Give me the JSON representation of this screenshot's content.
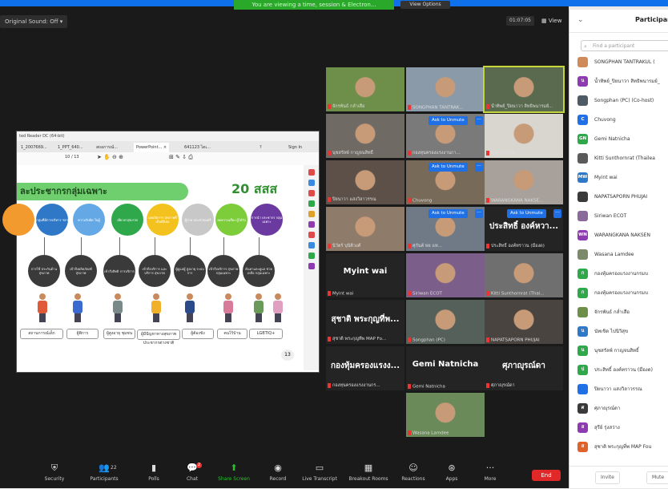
{
  "banner": {
    "text": "You are viewing a time, session & Electron...",
    "button": "View Options"
  },
  "topbar": {
    "sound": "Original Sound: Off ▾",
    "timer": "01:07:05",
    "view": "▦ View"
  },
  "slide": {
    "app_title": "ted Reader DC (64-bit)",
    "tabs": [
      "1_2007669...",
      "1_PPT_640...",
      "สถอการณ์...",
      "PowerPoint... ×",
      "641123 ไดเ...",
      "?",
      "Sign In"
    ],
    "zoom": "10 / 13",
    "header": "ละประชากรกลุ่มเฉพาะ",
    "logo": "20 สสส",
    "page_number": "13",
    "top_circles": [
      {
        "text": "",
        "color": "#f39a2e"
      },
      {
        "text": "กลุ่มที่มีการบริหาร ฯลฯ",
        "color": "#2f77c7"
      },
      {
        "text": "ความรับผิด ในผู้",
        "color": "#64a9e6"
      },
      {
        "text": "เยียวยาสุขภาพ",
        "color": "#2fa84c"
      },
      {
        "text": "ผลผลิตการ สุขภาพที่เป็นที่นิยม",
        "color": "#f4c21f"
      },
      {
        "text": "ผู้ป่วย ประชาชนตรี",
        "color": "#c8c8c8"
      },
      {
        "text": "ลดความเสี่ยง ผู้ได้รับ",
        "color": "#7dcc3a"
      },
      {
        "text": "การนำ ประชากร กลุ่มเฉพาะ",
        "color": "#6b3aa0"
      }
    ],
    "bottom_circles": [
      "การใช้ ประกันด้าน สุขภาพ",
      "เข้าถึงผลิตภัณฑ์ สุขภาพ",
      "เข้าถึงสิทธิ การบริการ",
      "เข้าถึงบริการ และบริการ สุขภาพ",
      "ผู้ดูแลผู้ สูงอายุ ระบบการ",
      "เข้าถึงบริการ สุขภาพ กลุ่มเฉพาะ",
      "ค้นหาและดูแล ช่วยเหลือ กลุ่มเฉพาะ"
    ],
    "labels": [
      "สถานการณ์เด็ก",
      "ผู้พิการ",
      "ผู้สูงอายุ ชุมชน",
      "ผู้มีปัญหาทางสุขภาพ ประชากรต่างชาติ",
      "ผู้ต้องขัง",
      "คนไร้บ้าน",
      "LGBTIQ+"
    ]
  },
  "tiles": [
    {
      "name": "จักรพันธ์ กล่ำเสือ",
      "kind": "photo",
      "color": "#6e8f4a"
    },
    {
      "name": "SONGPHAN TANTRAK...",
      "kind": "photo",
      "color": "#8a9aa8"
    },
    {
      "name": "น้ำทิพย์_ปิยนาวา สิทธิพนารมย์...",
      "kind": "photo",
      "color": "#5a6a4e",
      "active": true
    },
    {
      "name": "นุชสรัลพ์ กาญจนสิทธิ์",
      "kind": "photo",
      "color": "#6f6a64"
    },
    {
      "name": "กองทุนครองแรงงานกา...",
      "kind": "photo",
      "color": "#7a7a7a",
      "unmute": true
    },
    {
      "name": "สุรีย์ รุ่งสว่าง",
      "kind": "photo",
      "color": "#d9d5cf"
    },
    {
      "name": "ปิยนาวา แสงวิลาวรรณ",
      "kind": "photo",
      "color": "#5c5048"
    },
    {
      "name": "Chuvong",
      "kind": "photo",
      "color": "#786a58",
      "unmute": true
    },
    {
      "name": "WARANGKANA NAKSE...",
      "kind": "photo",
      "color": "#a8a09a"
    },
    {
      "name": "นิวัตร์ บุนิติวงศ์",
      "kind": "photo",
      "color": "#8f7b6a"
    },
    {
      "name": "ศุกันต์ พ่ย แท...",
      "kind": "photo",
      "color": "#6f7a86",
      "unmute": true
    },
    {
      "name": "ประสิทธิ์ องค์ทราวน (มืองด)",
      "kind": "name",
      "big": "ประสิทธิ์ องค์หวา...",
      "unmute": true
    },
    {
      "name": "Myint wai",
      "kind": "name",
      "big": "Myint wai"
    },
    {
      "name": "Siriwan ECOT",
      "kind": "photo",
      "color": "#7c5e8a"
    },
    {
      "name": "Kitti Sunthornrat (Thai...",
      "kind": "photo",
      "color": "#6f6f6f"
    },
    {
      "name": "สุชาติ พระกุญทีพ MAP Fo...",
      "kind": "name",
      "big": "สุชาติ พระกุญที่พ..."
    },
    {
      "name": "Songphan (PC)",
      "kind": "photo",
      "color": "#55605a"
    },
    {
      "name": "NAPATSAPORN PHUJAI",
      "kind": "photo",
      "color": "#4a4440"
    },
    {
      "name": "กองทุนครองแรงงานกร...",
      "kind": "name",
      "big": "กองทุ้มครองแรงง..."
    },
    {
      "name": "Gemi Natnicha",
      "kind": "name",
      "big": "Gemi Natnicha"
    },
    {
      "name": "ศุภาญุรณ์ดา",
      "kind": "name",
      "big": "ศุภาญุรณ์ดา"
    },
    {
      "name": "Wasana Lamdee",
      "kind": "photo",
      "color": "#6b8a5a"
    }
  ],
  "unmute": {
    "label": "Ask to Unmute",
    "more": "···"
  },
  "toolbar": {
    "security": "Security",
    "participants": "Participants",
    "participants_count": "22",
    "polls": "Polls",
    "chat": "Chat",
    "chat_badge": "2",
    "share": "Share Screen",
    "record": "Record",
    "transcript": "Live Transcript",
    "breakout": "Breakout Rooms",
    "reactions": "Reactions",
    "apps": "Apps",
    "more": "More",
    "end": "End"
  },
  "panel": {
    "title": "Participant",
    "search_placeholder": "Find a participant",
    "invite": "Invite",
    "mute": "Mute",
    "participants": [
      {
        "initials": "",
        "name": "SONGPHAN TANTRAKUL (",
        "color": "#d08a5a"
      },
      {
        "initials": "น",
        "name": "น้ำทิพย์_ปิยนาวา สิทธิพนารมย์_",
        "color": "#8e3ab0"
      },
      {
        "initials": "",
        "name": "Songphan (PC) (Co-host)",
        "color": "#4e5a64"
      },
      {
        "initials": "C",
        "name": "Chuvong",
        "color": "#1f6fe5"
      },
      {
        "initials": "GN",
        "name": "Gemi Natnicha",
        "color": "#2fa84c"
      },
      {
        "initials": "",
        "name": "Kitti Sunthornrat (Thailea",
        "color": "#5a5a5a"
      },
      {
        "initials": "MW",
        "name": "Myint wai",
        "color": "#2f77c7"
      },
      {
        "initials": "",
        "name": "NAPATSAPORN PHUJAI",
        "color": "#3a3a3a"
      },
      {
        "initials": "",
        "name": "Siriwan ECOT",
        "color": "#8a6a9a"
      },
      {
        "initials": "WN",
        "name": "WARANGKANA NAKSEN",
        "color": "#8e3ab0"
      },
      {
        "initials": "",
        "name": "Wasana Lamdee",
        "color": "#7a8a6a"
      },
      {
        "initials": "ก",
        "name": "กองทุ้มครองแรงงานกรมบ",
        "color": "#2fa84c"
      },
      {
        "initials": "ก",
        "name": "กองทุ้มครองแรงงานกรมบ",
        "color": "#2fa84c"
      },
      {
        "initials": "",
        "name": "จักรพันธ์ กล่ำเสือ",
        "color": "#6e8f4a"
      },
      {
        "initials": "น",
        "name": "นัทเขิด ไปนิวิสุข",
        "color": "#2f77c7"
      },
      {
        "initials": "น",
        "name": "นุชสรัลพ์ กาญจนสิทธิ์",
        "color": "#2fa84c"
      },
      {
        "initials": "ป",
        "name": "ประสิทธิ์ องค์ทราวน (มืองด)",
        "color": "#2fa84c"
      },
      {
        "initials": "",
        "name": "ปิยนาวา แสงวิลาวรรณ",
        "color": "#1f6fe5"
      },
      {
        "initials": "ศ",
        "name": "ศุภาญุรณ์ดา",
        "color": "#3a3a3a"
      },
      {
        "initials": "ส",
        "name": "สุรีย์ รุ่งสว่าง",
        "color": "#8e3ab0"
      },
      {
        "initials": "ส",
        "name": "สุชาติ พระกุญที่พ MAP Fou",
        "color": "#e0622a"
      }
    ]
  }
}
